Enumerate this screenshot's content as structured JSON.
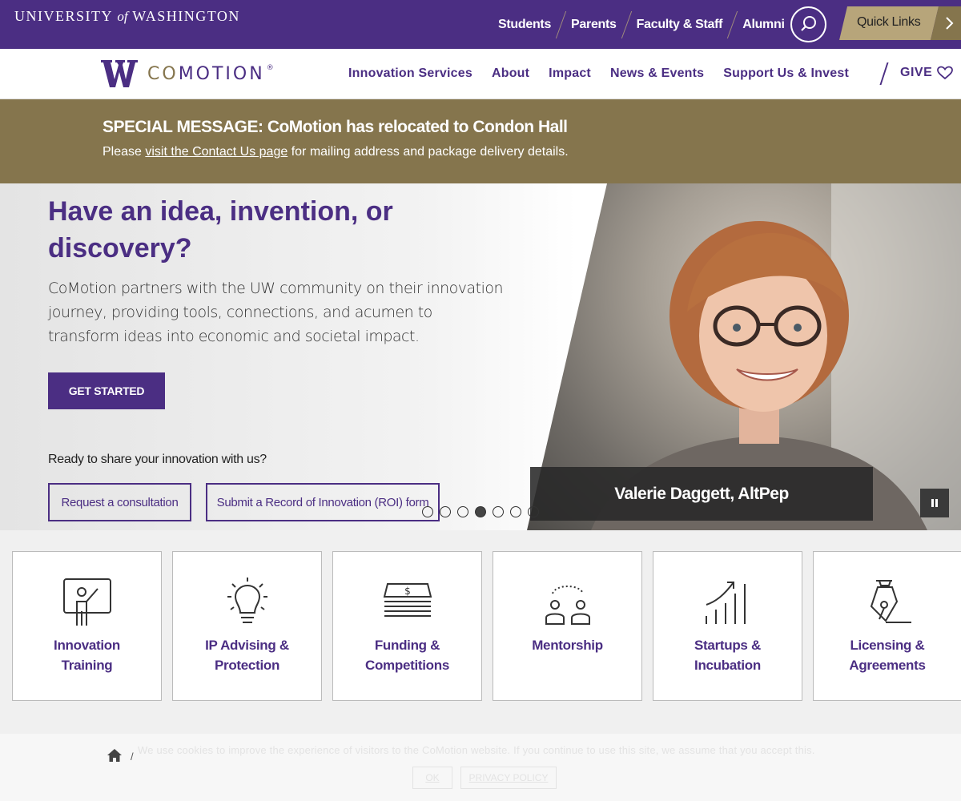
{
  "uw_bar": {
    "wordmark_left": "UNIVERSITY",
    "wordmark_of": "of",
    "wordmark_right": "WASHINGTON",
    "links": [
      "Students",
      "Parents",
      "Faculty & Staff",
      "Alumni"
    ],
    "quick_links": "Quick Links"
  },
  "header": {
    "logo_co": "CO",
    "logo_motion": "MOTION",
    "logo_reg": "®",
    "nav": [
      "Innovation Services",
      "About",
      "Impact",
      "News & Events",
      "Support Us & Invest"
    ],
    "give": "GIVE"
  },
  "special_message": {
    "title": "SPECIAL MESSAGE: CoMotion has relocated to Condon Hall",
    "text_before": "Please ",
    "link": "visit the Contact Us page",
    "text_after": " for mailing address and package delivery details."
  },
  "hero": {
    "title": "Have an idea, invention, or discovery?",
    "description": "CoMotion partners with the UW community on their innovation journey, providing tools, connections, and acumen to transform ideas into economic and societal impact.",
    "cta": "GET STARTED",
    "ready": "Ready to share your innovation with us?",
    "btn_consult": "Request a consultation",
    "btn_roi": "Submit a Record of Innovation (ROI) form",
    "caption": "Valerie Daggett, AltPep",
    "slide_count": 7,
    "active_slide": 4
  },
  "cards": [
    {
      "label": "Innovation Training",
      "icon": "training-icon"
    },
    {
      "label": "IP Advising & Protection",
      "icon": "lightbulb-icon"
    },
    {
      "label": "Funding & Competitions",
      "icon": "money-icon"
    },
    {
      "label": "Mentorship",
      "icon": "mentorship-icon"
    },
    {
      "label": "Startups & Incubation",
      "icon": "growth-chart-icon"
    },
    {
      "label": "Licensing & Agreements",
      "icon": "pen-nib-icon"
    }
  ],
  "breadcrumb": {
    "separator": "/"
  },
  "cookie": {
    "text": "We use cookies to improve the experience of visitors to the CoMotion website. If you continue to use this site, we assume that you accept this.",
    "ok": "OK",
    "privacy": "PRIVACY POLICY"
  }
}
